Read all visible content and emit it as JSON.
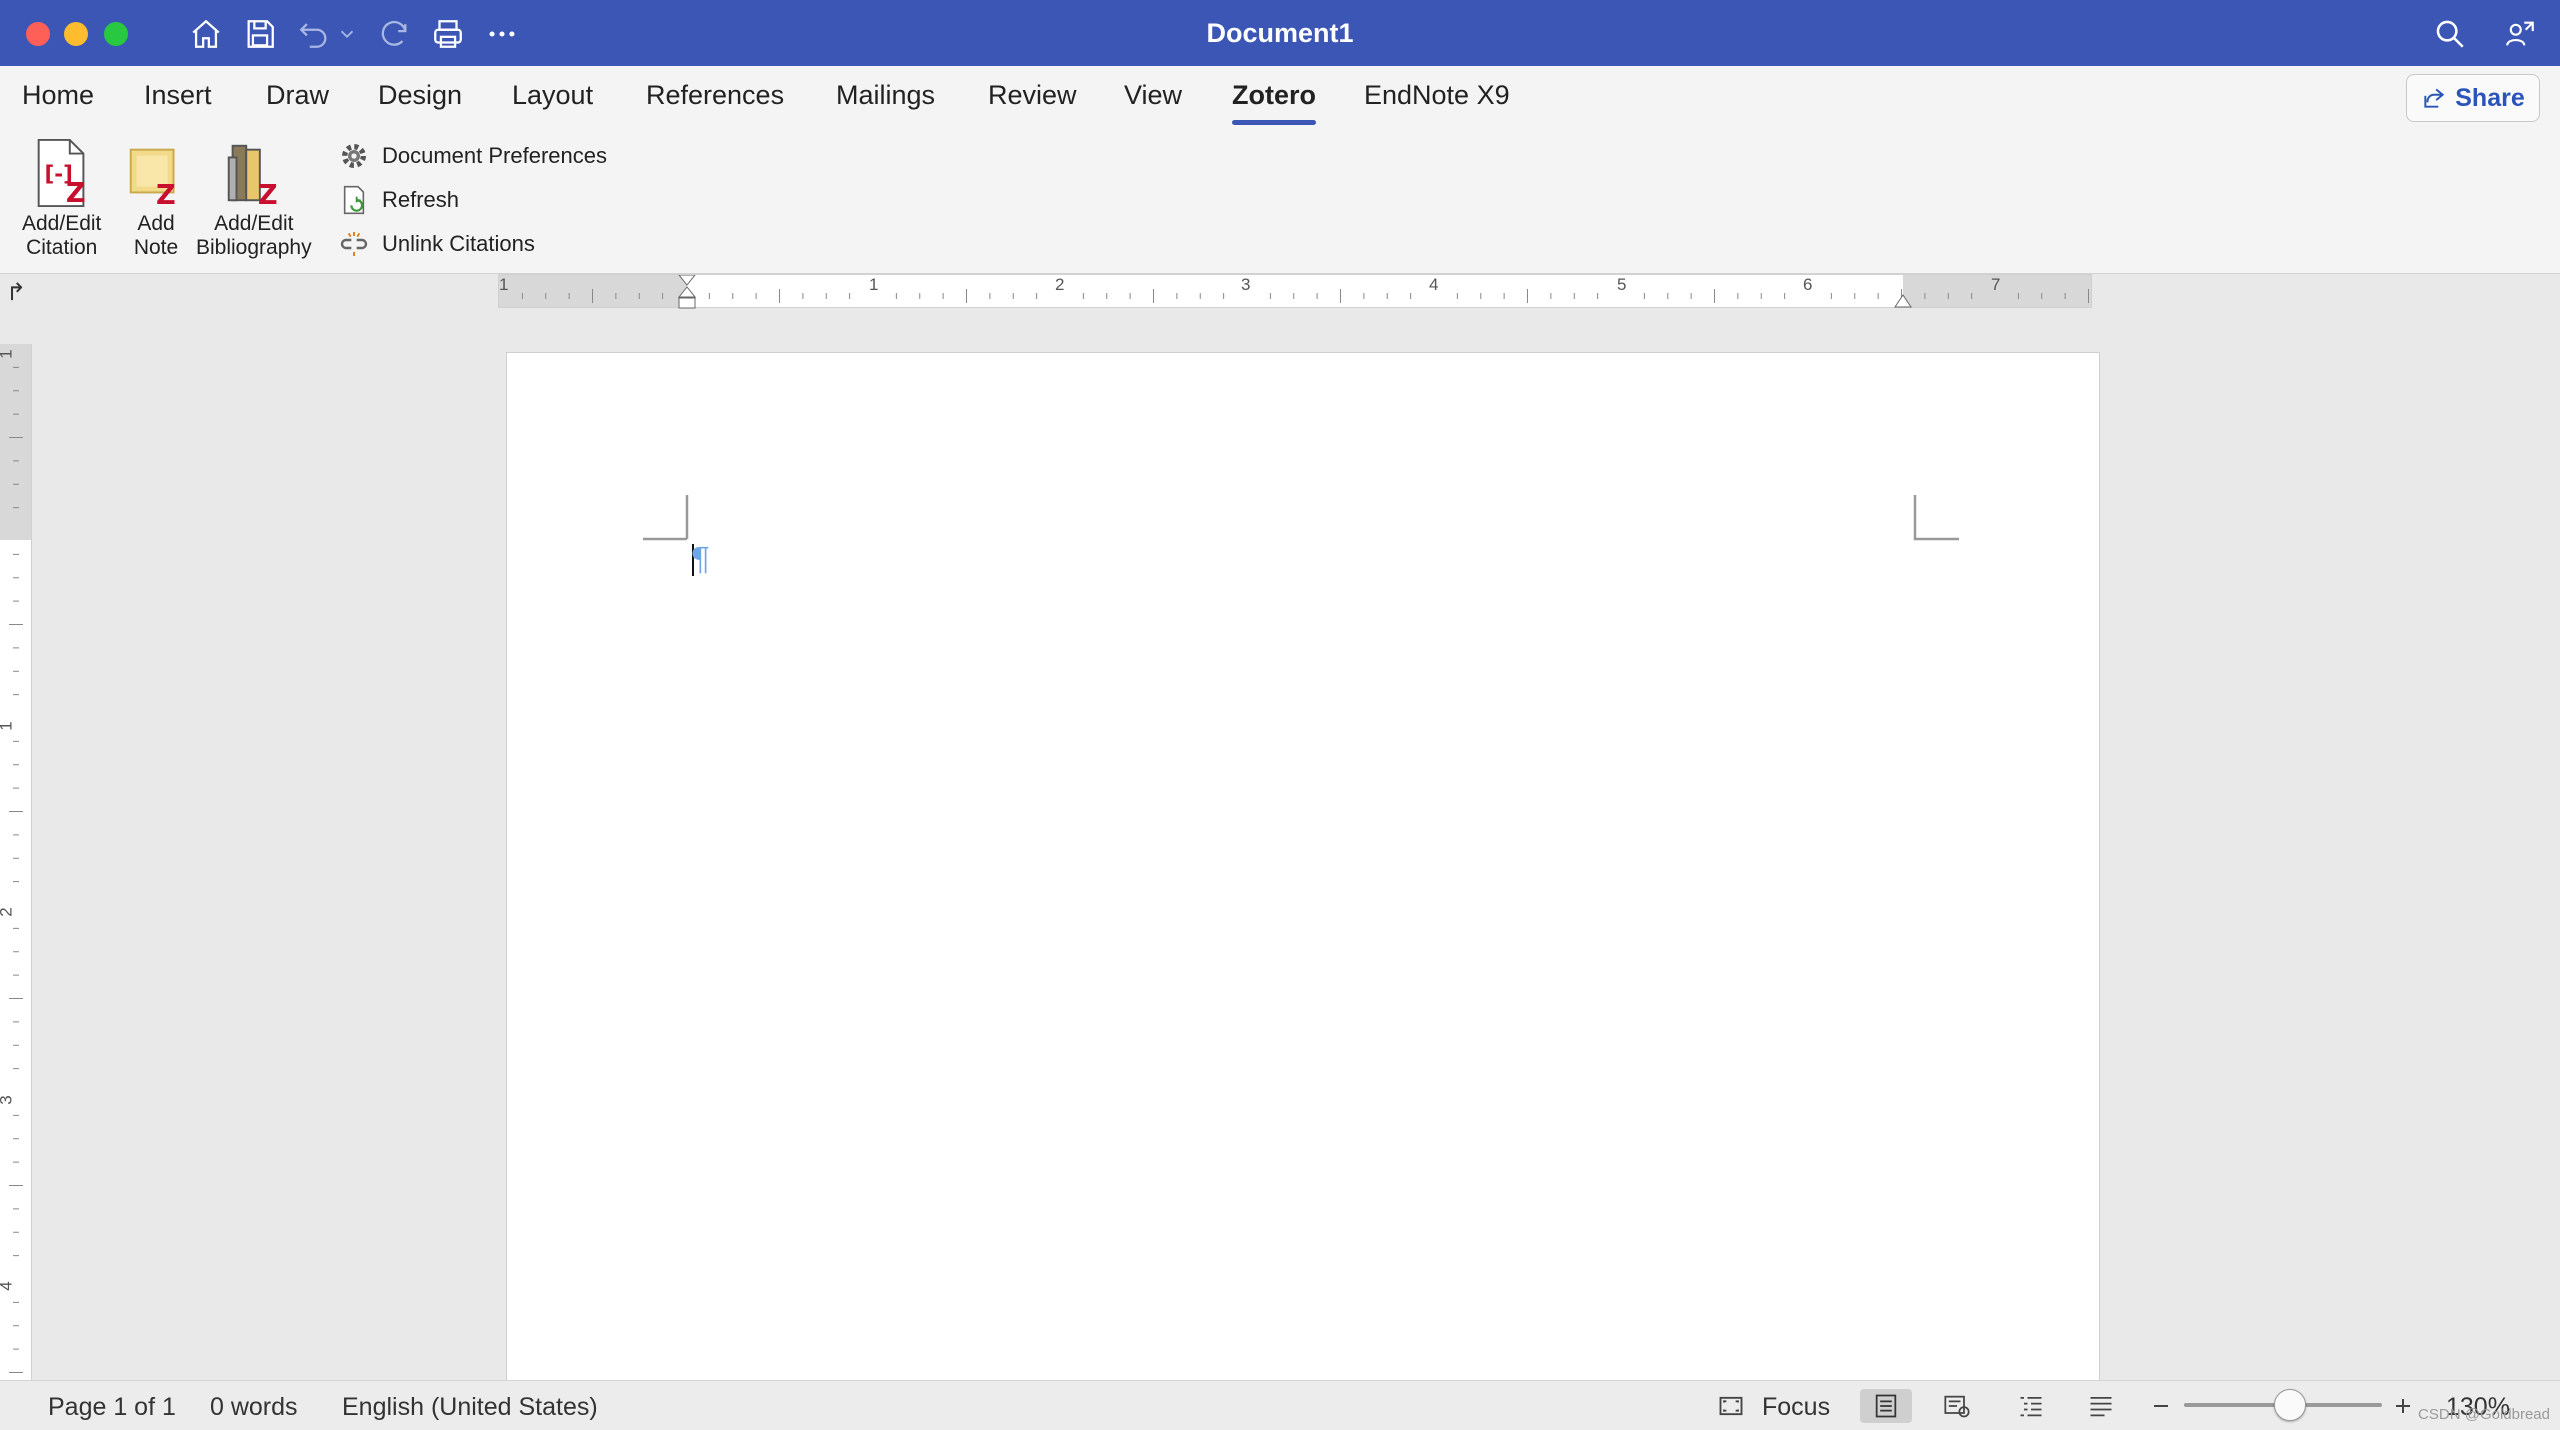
{
  "window": {
    "title": "Document1"
  },
  "tabs": [
    {
      "label": "Home"
    },
    {
      "label": "Insert"
    },
    {
      "label": "Draw"
    },
    {
      "label": "Design"
    },
    {
      "label": "Layout"
    },
    {
      "label": "References"
    },
    {
      "label": "Mailings"
    },
    {
      "label": "Review"
    },
    {
      "label": "View"
    },
    {
      "label": "Zotero",
      "active": true
    },
    {
      "label": "EndNote X9"
    }
  ],
  "share": {
    "label": "Share"
  },
  "ribbon": {
    "add_edit_citation": {
      "line1": "Add/Edit",
      "line2": "Citation"
    },
    "add_note": {
      "line1": "Add",
      "line2": "Note"
    },
    "add_edit_bibliography": {
      "line1": "Add/Edit",
      "line2": "Bibliography"
    },
    "document_preferences": "Document Preferences",
    "refresh": "Refresh",
    "unlink_citations": "Unlink Citations"
  },
  "ruler": {
    "horizontal_numbers": [
      "1",
      "1",
      "2",
      "3",
      "4",
      "5",
      "6",
      "7"
    ],
    "vertical_numbers": [
      "1",
      "1",
      "2",
      "3",
      "4"
    ]
  },
  "document": {
    "pilcrow": "¶"
  },
  "status": {
    "page": "Page 1 of 1",
    "words": "0 words",
    "language": "English (United States)",
    "focus": "Focus",
    "zoom": "130%",
    "zoom_level": 0.5
  },
  "watermark": "CSDN @Goldbread",
  "colors": {
    "titlebar": "#3b56b4",
    "accent": "#3b56b4",
    "zotero_red": "#c8102e"
  }
}
